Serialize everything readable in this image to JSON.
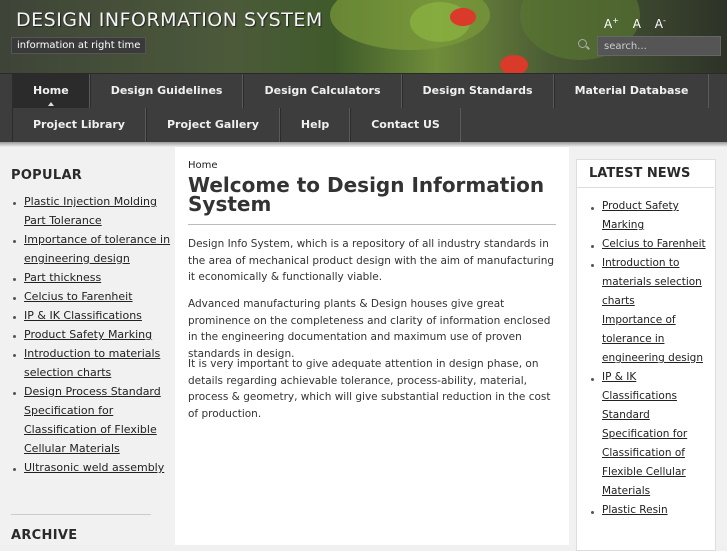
{
  "header": {
    "site_title": "DESIGN INFORMATION SYSTEM",
    "tagline": "information at right time",
    "font_controls": [
      "A+",
      "A",
      "A-"
    ],
    "search_placeholder": "search...",
    "icons": {
      "search": "search-icon"
    }
  },
  "nav": {
    "row1": [
      "Home",
      "Design Guidelines",
      "Design Calculators",
      "Design Standards",
      "Material Database"
    ],
    "row2": [
      "Project Library",
      "Project Gallery",
      "Help",
      "Contact US"
    ],
    "active": "Home"
  },
  "left": {
    "popular_heading": "POPULAR",
    "popular": [
      "Plastic Injection Molding Part Tolerance",
      "Importance of tolerance in engineering design",
      "Part thickness",
      "Celcius to Farenheit",
      "IP & IK Classifications",
      "Product Safety Marking",
      "Introduction to materials selection charts",
      "Design Process Standard Specification for Classification of Flexible Cellular Materials",
      "Ultrasonic weld assembly"
    ],
    "archive_heading": "ARCHIVE"
  },
  "main": {
    "breadcrumb": "Home",
    "title": "Welcome to Design Information System",
    "paragraphs": [
      "Design Info System, which is a repository of all industry standards in the area of mechanical product design with the aim of manufacturing it economically & functionally viable.",
      "Advanced manufacturing plants & Design houses give great prominence on the completeness and clarity of information enclosed in the engineering documentation and maximum use of proven standards in design.",
      "It is very important to give adequate attention in design phase, on details regarding achievable tolerance, process-ability, material, process & geometry, which will give substantial reduction in the cost of production."
    ]
  },
  "right": {
    "news_heading": "LATEST NEWS",
    "news": [
      "Product Safety Marking",
      "Celcius to Farenheit",
      "Introduction to materials selection charts",
      "Importance of tolerance in engineering design",
      "IP & IK Classifications",
      "Standard Specification for Classification of Flexible Cellular Materials",
      "Plastic Resin"
    ]
  },
  "colors": {
    "nav_bg": "#3d3d3d",
    "header_bg": "#4c5a3a",
    "page_bg": "#f0f0f0"
  }
}
